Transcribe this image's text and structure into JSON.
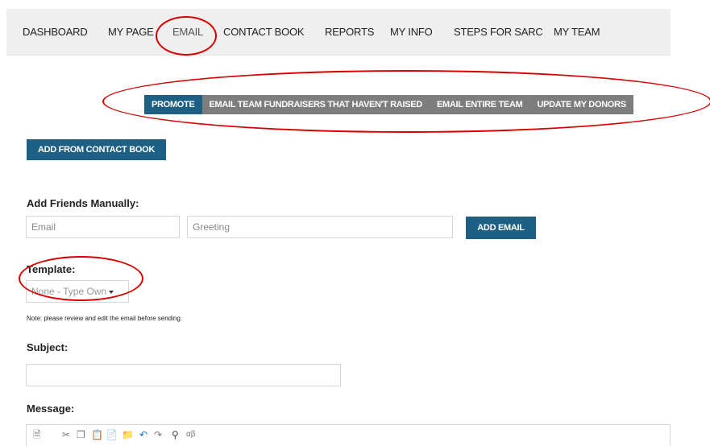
{
  "nav": {
    "items": [
      "DASHBOARD",
      "MY PAGE",
      "EMAIL",
      "CONTACT BOOK",
      "REPORTS",
      "MY INFO",
      "STEPS FOR SARC",
      "MY TEAM"
    ],
    "active": "EMAIL"
  },
  "subtabs": {
    "items": [
      "PROMOTE",
      "EMAIL TEAM FUNDRAISERS THAT HAVEN'T RAISED",
      "EMAIL ENTIRE TEAM",
      "UPDATE MY DONORS"
    ],
    "active": "PROMOTE"
  },
  "contact_book_button": "ADD FROM CONTACT BOOK",
  "manual": {
    "label": "Add Friends Manually:",
    "email_placeholder": "Email",
    "greeting_placeholder": "Greeting",
    "add_button": "ADD EMAIL"
  },
  "template": {
    "label": "Template:",
    "selected": "None - Type Own"
  },
  "note": "Note: please review and edit the email before sending.",
  "subject": {
    "label": "Subject:",
    "value": ""
  },
  "message": {
    "label": "Message:",
    "toolbar_icons": [
      "source-icon",
      "cut-icon",
      "copy-icon",
      "paste-icon",
      "paste-text-icon",
      "paste-word-icon",
      "undo-icon",
      "redo-icon",
      "find-icon",
      "spellcheck-icon"
    ]
  },
  "colors": {
    "primary": "#1e5f84",
    "tab_gray": "#7d7d7d",
    "annotation": "#d80000"
  }
}
